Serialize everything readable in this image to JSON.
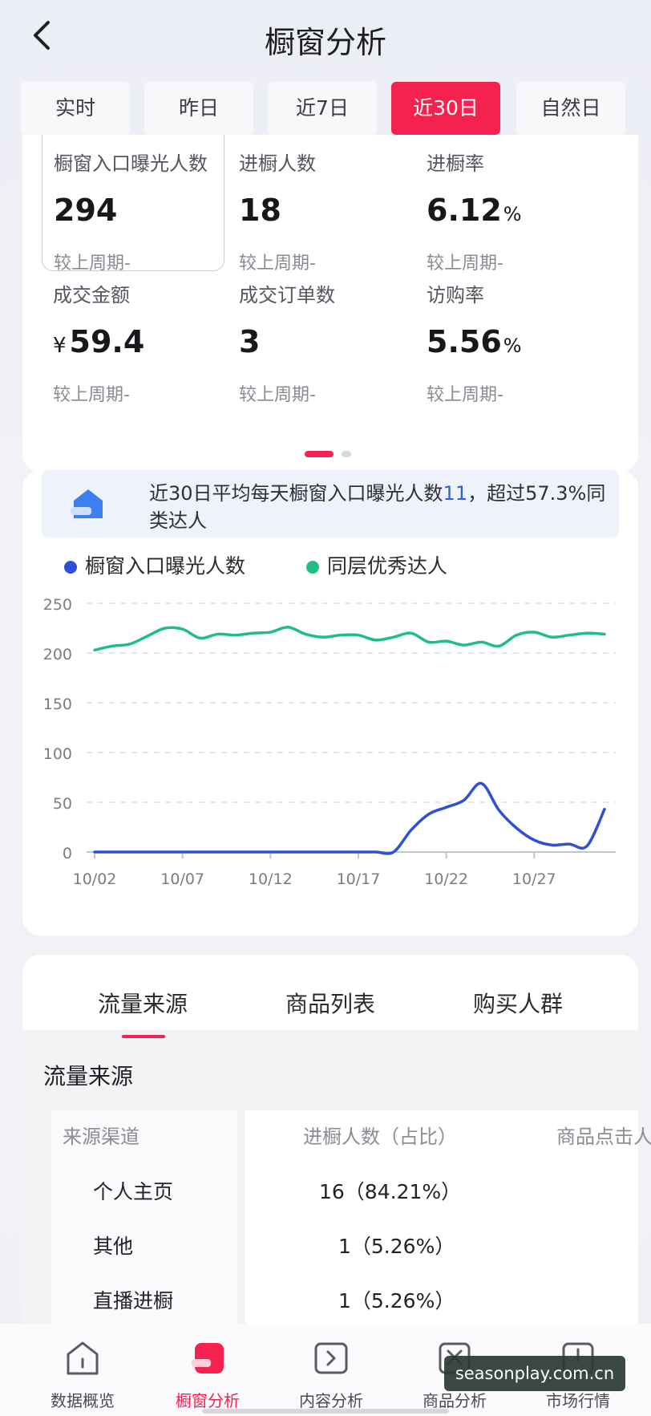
{
  "header": {
    "title": "橱窗分析"
  },
  "period_tabs": [
    {
      "label": "实时"
    },
    {
      "label": "昨日"
    },
    {
      "label": "近7日"
    },
    {
      "label": "近30日",
      "active": true
    },
    {
      "label": "自然日"
    }
  ],
  "metrics": [
    {
      "label": "橱窗入口曝光人数",
      "value": "294",
      "unit": "",
      "prefix": "",
      "compare": "较上周期-",
      "selected": true
    },
    {
      "label": "进橱人数",
      "value": "18",
      "unit": "",
      "prefix": "",
      "compare": "较上周期-"
    },
    {
      "label": "进橱率",
      "value": "6.12",
      "unit": "%",
      "prefix": "",
      "compare": "较上周期-"
    },
    {
      "label": "成交金额",
      "value": "59.4",
      "unit": "",
      "prefix": "¥",
      "compare": "较上周期-"
    },
    {
      "label": "成交订单数",
      "value": "3",
      "unit": "",
      "prefix": "",
      "compare": "较上周期-"
    },
    {
      "label": "访购率",
      "value": "5.56",
      "unit": "%",
      "prefix": "",
      "compare": "较上周期-"
    }
  ],
  "insight": {
    "text_before": "近30日平均每天橱窗入口曝光人数",
    "highlight": "11",
    "text_after": "，超过57.3%同类达人"
  },
  "colors": {
    "accent": "#f5224f",
    "series_1": "#2f4fd6",
    "series_2": "#1fbf84"
  },
  "chart_data": {
    "type": "line",
    "x": [
      "10/02",
      "10/03",
      "10/04",
      "10/05",
      "10/06",
      "10/07",
      "10/08",
      "10/09",
      "10/10",
      "10/11",
      "10/12",
      "10/13",
      "10/14",
      "10/15",
      "10/16",
      "10/17",
      "10/18",
      "10/19",
      "10/20",
      "10/21",
      "10/22",
      "10/23",
      "10/24",
      "10/25",
      "10/26",
      "10/27",
      "10/28",
      "10/29",
      "10/30",
      "10/31"
    ],
    "x_tick_labels": [
      "10/02",
      "10/07",
      "10/12",
      "10/17",
      "10/22",
      "10/27"
    ],
    "yticks": [
      0,
      50,
      100,
      150,
      200,
      250
    ],
    "ylim": [
      0,
      250
    ],
    "grid": true,
    "legend_position": "top-left",
    "series": [
      {
        "name": "橱窗入口曝光人数",
        "color": "#2f4fd6",
        "values": [
          0,
          0,
          0,
          0,
          0,
          0,
          0,
          0,
          0,
          0,
          0,
          0,
          0,
          0,
          0,
          0,
          0,
          0,
          22,
          38,
          45,
          52,
          69,
          42,
          24,
          12,
          7,
          8,
          6,
          43
        ]
      },
      {
        "name": "同层优秀达人",
        "color": "#1fbf84",
        "values": [
          203,
          207,
          209,
          217,
          225,
          224,
          215,
          219,
          218,
          220,
          221,
          226,
          219,
          216,
          218,
          218,
          213,
          216,
          220,
          211,
          212,
          208,
          211,
          207,
          218,
          221,
          216,
          218,
          220,
          219
        ]
      }
    ]
  },
  "section_tabs": [
    {
      "label": "流量来源",
      "active": true
    },
    {
      "label": "商品列表"
    },
    {
      "label": "购买人群"
    }
  ],
  "traffic": {
    "heading": "流量来源",
    "columns": [
      "来源渠道",
      "进橱人数（占比）",
      "商品点击人"
    ],
    "rows": [
      {
        "source": "个人主页",
        "visitors": "16（84.21%）"
      },
      {
        "source": "其他",
        "visitors": "1（5.26%）"
      },
      {
        "source": "直播进橱",
        "visitors": "1（5.26%）"
      }
    ]
  },
  "bottom_nav": [
    {
      "label": "数据概览",
      "icon": "home-icon"
    },
    {
      "label": "橱窗分析",
      "icon": "shop-window-icon",
      "active": true
    },
    {
      "label": "内容分析",
      "icon": "play-box-icon"
    },
    {
      "label": "商品分析",
      "icon": "box-icon"
    },
    {
      "label": "市场行情",
      "icon": "market-icon"
    }
  ],
  "watermark": "seasonplay.com.cn"
}
